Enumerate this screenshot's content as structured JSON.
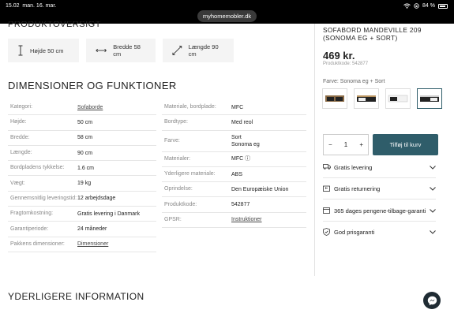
{
  "status_bar": {
    "time": "15.02",
    "date": "man. 16. mar.",
    "url": "myhomemobler.dk",
    "battery": "84 %"
  },
  "overview_heading": "PRODUKTOVERSIGT",
  "dimension_tiles": [
    {
      "icon": "height-arrow-icon",
      "label": "Højde 50 cm"
    },
    {
      "icon": "width-arrow-icon",
      "label": "Bredde 58 cm"
    },
    {
      "icon": "length-arrow-icon",
      "label": "Længde 90 cm"
    }
  ],
  "specs_heading": "DIMENSIONER OG FUNKTIONER",
  "specs_left": [
    {
      "key": "Kategori:",
      "value": "Sofaborde",
      "link": true
    },
    {
      "key": "Højde:",
      "value": "50 cm"
    },
    {
      "key": "Bredde:",
      "value": "58 cm"
    },
    {
      "key": "Længde:",
      "value": "90 cm"
    },
    {
      "key": "Bordpladens tykkelse:",
      "value": "1.6 cm"
    },
    {
      "key": "Vægt:",
      "value": "19 kg"
    },
    {
      "key": "Gennemsnitlig leveringstid:",
      "value": "12 arbejdsdage"
    },
    {
      "key": "Fragtomkostning:",
      "value": "Gratis levering i Danmark"
    },
    {
      "key": "Garantiperiode:",
      "value": "24 måneder"
    },
    {
      "key": "Pakkens dimensioner:",
      "value": "Dimensioner",
      "link": true
    }
  ],
  "specs_right": [
    {
      "key": "Materiale, bordplade:",
      "value": "MFC"
    },
    {
      "key": "Bordtype:",
      "value": "Med reol"
    },
    {
      "key": "Farve:",
      "value": "Sort\nSonoma eg"
    },
    {
      "key": "Materialer:",
      "value": "MFC ⓘ"
    },
    {
      "key": "Yderligere materiale:",
      "value": "ABS"
    },
    {
      "key": "Oprindelse:",
      "value": "Den Europæiske Union"
    },
    {
      "key": "Produktkode:",
      "value": "542877"
    },
    {
      "key": "GPSR:",
      "value": "Instruktioner",
      "link": true
    }
  ],
  "more_info_heading": "YDERLIGERE INFORMATION",
  "product": {
    "title": "SOFABORD MANDEVILLE 209 (SONOMA EG + SORT)",
    "price": "469 kr.",
    "code_label": "Produktkode: 542877",
    "color_label": "Farve: Sonoma eg + Sort",
    "quantity": "1",
    "minus": "−",
    "plus": "+",
    "add_to_cart": "Tilføj til kurv"
  },
  "accordion": [
    {
      "icon": "truck-icon",
      "label": "Gratis levering"
    },
    {
      "icon": "return-box-icon",
      "label": "Gratis returnering"
    },
    {
      "icon": "calendar-icon",
      "label": "365 dages pengene-tilbage-garanti"
    },
    {
      "icon": "shield-check-icon",
      "label": "God prisgaranti"
    }
  ],
  "colors": {
    "accent": "#2f5d6a",
    "statusbar": "#000000",
    "chat_fab": "#1f2b33"
  }
}
